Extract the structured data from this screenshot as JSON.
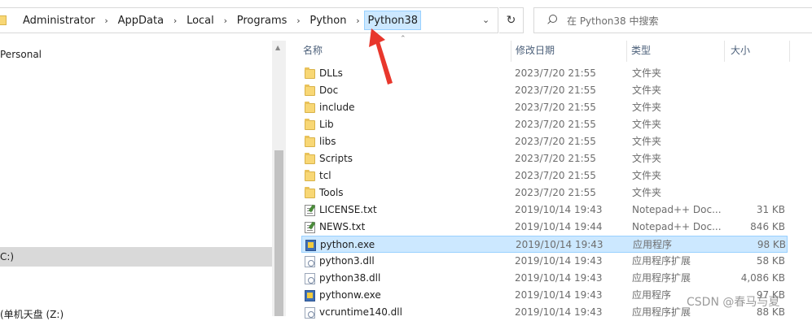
{
  "address_bar": {
    "breadcrumbs": [
      "Administrator",
      "AppData",
      "Local",
      "Programs",
      "Python",
      "Python38"
    ],
    "dropdown_icon": "chevron-down-icon",
    "refresh_icon": "refresh-icon"
  },
  "search": {
    "placeholder": "在 Python38 中搜索",
    "icon": "search-icon"
  },
  "nav": {
    "items": [
      {
        "label": "Personal"
      },
      {
        "label": "C:)"
      },
      {
        "label": "(单机天盘 (Z:)"
      }
    ]
  },
  "columns": {
    "name": "名称",
    "date": "修改日期",
    "type": "类型",
    "size": "大小"
  },
  "files": [
    {
      "name": "DLLs",
      "date": "2023/7/20 21:55",
      "type": "文件夹",
      "size": "",
      "icon": "folder-icon"
    },
    {
      "name": "Doc",
      "date": "2023/7/20 21:55",
      "type": "文件夹",
      "size": "",
      "icon": "folder-icon"
    },
    {
      "name": "include",
      "date": "2023/7/20 21:55",
      "type": "文件夹",
      "size": "",
      "icon": "folder-icon"
    },
    {
      "name": "Lib",
      "date": "2023/7/20 21:55",
      "type": "文件夹",
      "size": "",
      "icon": "folder-icon"
    },
    {
      "name": "libs",
      "date": "2023/7/20 21:55",
      "type": "文件夹",
      "size": "",
      "icon": "folder-icon"
    },
    {
      "name": "Scripts",
      "date": "2023/7/20 21:55",
      "type": "文件夹",
      "size": "",
      "icon": "folder-icon"
    },
    {
      "name": "tcl",
      "date": "2023/7/20 21:55",
      "type": "文件夹",
      "size": "",
      "icon": "folder-icon"
    },
    {
      "name": "Tools",
      "date": "2023/7/20 21:55",
      "type": "文件夹",
      "size": "",
      "icon": "folder-icon"
    },
    {
      "name": "LICENSE.txt",
      "date": "2019/10/14 19:43",
      "type": "Notepad++ Doc...",
      "size": "31 KB",
      "icon": "text-file-icon"
    },
    {
      "name": "NEWS.txt",
      "date": "2019/10/14 19:44",
      "type": "Notepad++ Doc...",
      "size": "846 KB",
      "icon": "text-file-icon"
    },
    {
      "name": "python.exe",
      "date": "2019/10/14 19:43",
      "type": "应用程序",
      "size": "98 KB",
      "icon": "exe-icon",
      "selected": true
    },
    {
      "name": "python3.dll",
      "date": "2019/10/14 19:43",
      "type": "应用程序扩展",
      "size": "58 KB",
      "icon": "dll-icon"
    },
    {
      "name": "python38.dll",
      "date": "2019/10/14 19:43",
      "type": "应用程序扩展",
      "size": "4,086 KB",
      "icon": "dll-icon"
    },
    {
      "name": "pythonw.exe",
      "date": "2019/10/14 19:43",
      "type": "应用程序",
      "size": "97 KB",
      "icon": "exe-icon"
    },
    {
      "name": "vcruntime140.dll",
      "date": "2019/10/14 19:43",
      "type": "应用程序扩展",
      "size": "88 KB",
      "icon": "dll-icon"
    }
  ],
  "annotation": {
    "color": "#e8372c",
    "icon": "red-arrow"
  },
  "watermark": "CSDN @春马与夏"
}
